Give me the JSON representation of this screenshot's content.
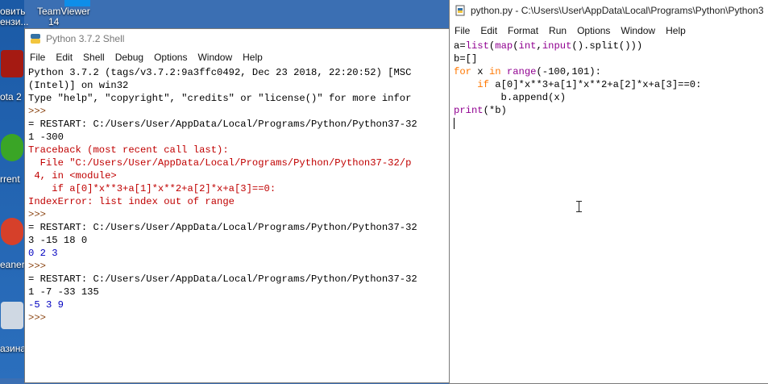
{
  "desktop": {
    "top_labels": [
      "овить",
      "TeamViewer"
    ],
    "sub_labels": [
      "ензи...",
      "14"
    ],
    "icons": [
      {
        "label": "ota 2",
        "icon": "dota-icon"
      },
      {
        "label": "rrent",
        "icon": "utorrent-icon"
      },
      {
        "label": "eaner",
        "icon": "ccleaner-icon"
      },
      {
        "label": "азина",
        "icon": "recycle-bin-icon"
      }
    ]
  },
  "shell": {
    "title": "Python 3.7.2 Shell",
    "menu": [
      "File",
      "Edit",
      "Shell",
      "Debug",
      "Options",
      "Window",
      "Help"
    ],
    "lines": [
      {
        "t": "Python 3.7.2 (tags/v3.7.2:9a3ffc0492, Dec 23 2018, 22:20:52) [MSC",
        "c": "blk"
      },
      {
        "t": "(Intel)] on win32",
        "c": "blk"
      },
      {
        "t": "Type \"help\", \"copyright\", \"credits\" or \"license()\" for more infor",
        "c": "blk"
      },
      {
        "t": ">>>",
        "c": "prompt"
      },
      {
        "t": "= RESTART: C:/Users/User/AppData/Local/Programs/Python/Python37-32",
        "c": "blk"
      },
      {
        "t": "1 -300",
        "c": "blk"
      },
      {
        "t": "Traceback (most recent call last):",
        "c": "e"
      },
      {
        "t": "  File \"C:/Users/User/AppData/Local/Programs/Python/Python37-32/p",
        "c": "e"
      },
      {
        "t": " 4, in <module>",
        "c": "e"
      },
      {
        "t": "    if a[0]*x**3+a[1]*x**2+a[2]*x+a[3]==0:",
        "c": "e"
      },
      {
        "t": "IndexError: list index out of range",
        "c": "e"
      },
      {
        "t": ">>>",
        "c": "prompt"
      },
      {
        "t": "= RESTART: C:/Users/User/AppData/Local/Programs/Python/Python37-32",
        "c": "blk"
      },
      {
        "t": "3 -15 18 0",
        "c": "blk"
      },
      {
        "t": "0 2 3",
        "c": "o"
      },
      {
        "t": ">>>",
        "c": "prompt"
      },
      {
        "t": "= RESTART: C:/Users/User/AppData/Local/Programs/Python/Python37-32",
        "c": "blk"
      },
      {
        "t": "1 -7 -33 135",
        "c": "blk"
      },
      {
        "t": "-5 3 9",
        "c": "o"
      },
      {
        "t": ">>>",
        "c": "prompt"
      }
    ]
  },
  "editor": {
    "title": "python.py - C:\\Users\\User\\AppData\\Local\\Programs\\Python\\Python3",
    "menu": [
      "File",
      "Edit",
      "Format",
      "Run",
      "Options",
      "Window",
      "Help"
    ],
    "code_lines": [
      "a=list(map(int,input().split()))",
      "b=[]",
      "for x in range(-100,101):",
      "    if a[0]*x**3+a[1]*x**2+a[2]*x+a[3]==0:",
      "        b.append(x)",
      "print(*b)"
    ]
  },
  "colors": {
    "keyword": "#ff7700",
    "builtin": "#900090",
    "error": "#c00000",
    "output": "#0000c0",
    "prompt": "#8b4513"
  }
}
